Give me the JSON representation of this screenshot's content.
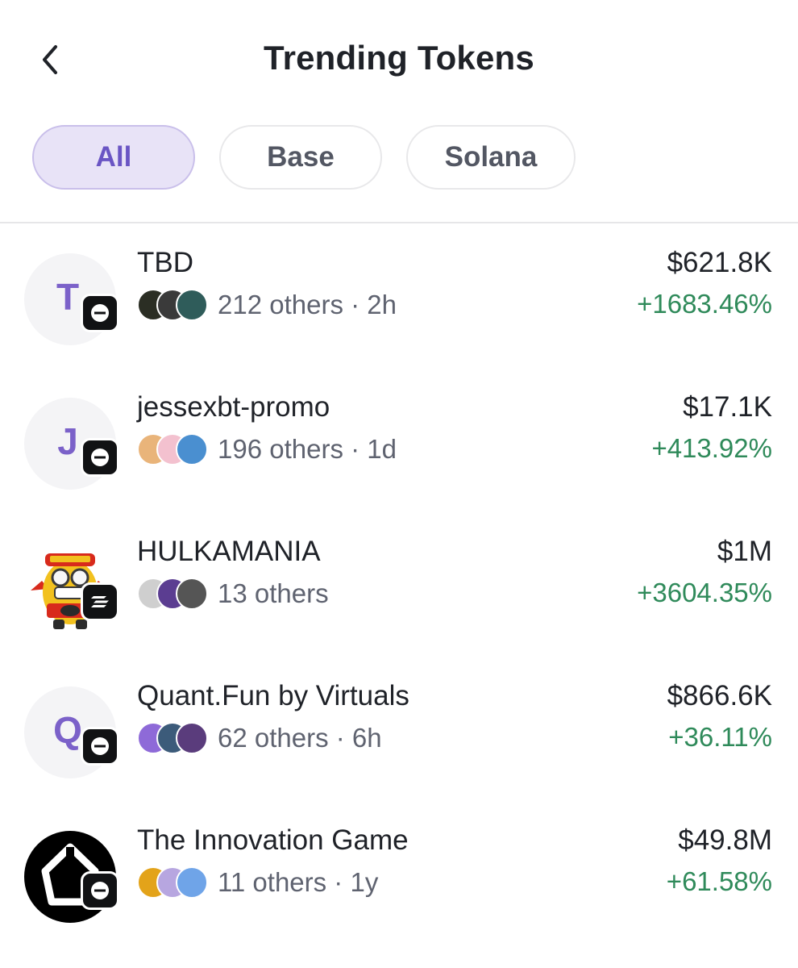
{
  "header": {
    "title": "Trending Tokens"
  },
  "filters": [
    {
      "label": "All",
      "active": true
    },
    {
      "label": "Base",
      "active": false
    },
    {
      "label": "Solana",
      "active": false
    }
  ],
  "tokens": [
    {
      "letter": "T",
      "name": "TBD",
      "meta": "212 others · 2h",
      "price": "$621.8K",
      "change": "+1683.46%",
      "chain": "base-icon"
    },
    {
      "letter": "J",
      "name": "jessexbt-promo",
      "meta": "196 others · 1d",
      "price": "$17.1K",
      "change": "+413.92%",
      "chain": "base-icon"
    },
    {
      "letter": "",
      "name": "HULKAMANIA",
      "meta": "13 others",
      "price": "$1M",
      "change": "+3604.35%",
      "chain": "solana-icon"
    },
    {
      "letter": "Q",
      "name": "Quant.Fun by Virtuals",
      "meta": "62 others · 6h",
      "price": "$866.6K",
      "change": "+36.11%",
      "chain": "base-icon"
    },
    {
      "letter": "",
      "name": "The Innovation Game",
      "meta": "11 others · 1y",
      "price": "$49.8M",
      "change": "+61.58%",
      "chain": "base-icon"
    }
  ],
  "colors": {
    "accent": "#6a55c4",
    "positive": "#2f8a5a"
  }
}
